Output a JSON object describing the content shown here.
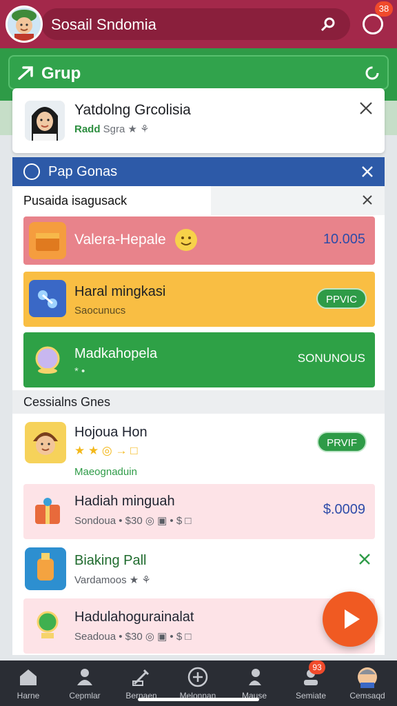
{
  "header": {
    "title": "Sosail Sndomia",
    "notification_count": "38"
  },
  "group": {
    "title": "Grup"
  },
  "profile": {
    "name": "Yatdolng Grcolisia",
    "sub_green": "Radd",
    "sub_gray": "Sgra",
    "sub_tail": "★ ⚘"
  },
  "panel": {
    "title": "Pap Gonas",
    "section_title": "Pusaida isagusack"
  },
  "featured": [
    {
      "title": "Valera-Hepale",
      "value": "10.005",
      "bg": "#e8838b"
    },
    {
      "title": "Haral mingkasi",
      "subtitle": "Saocunucs",
      "button": "PPVIC",
      "bg": "#f9be43"
    },
    {
      "title": "Madkahopela",
      "subtitle": "* •",
      "value": "SONUNOUS",
      "bg": "#2ea146"
    }
  ],
  "section2": {
    "title": "Cessialns Gnes"
  },
  "list": [
    {
      "title": "Hojoua Hon",
      "subtitle": "★ ★ ◎ → □",
      "tag": "Maeognaduin",
      "button": "PRVIF"
    },
    {
      "title": "Hadiah minguah",
      "subtitle": "Sondoua • $30 ◎ ▣ • $ □",
      "value": "$.0009"
    },
    {
      "title": "Biaking Pall",
      "subtitle": "Vardamoos ★ ⚘"
    },
    {
      "title": "Hadulahogurainalat",
      "subtitle": "Seadoua • $30 ◎ ▣ • $ □"
    }
  ],
  "nav": [
    {
      "label": "Harne",
      "icon": "home-icon"
    },
    {
      "label": "Cepmlar",
      "icon": "people-icon"
    },
    {
      "label": "Bernaen",
      "icon": "edit-icon"
    },
    {
      "label": "Melonnan",
      "icon": "plus-circle-icon"
    },
    {
      "label": "Mause",
      "icon": "person-icon"
    },
    {
      "label": "Semiate",
      "icon": "user-icon",
      "badge": "93"
    },
    {
      "label": "Cemsaqd",
      "icon": "profile-avatar-icon"
    }
  ],
  "colors": {
    "header": "#a3284a",
    "group": "#2e9b47",
    "panel_header": "#2d5aa8",
    "fab": "#f05a22"
  }
}
